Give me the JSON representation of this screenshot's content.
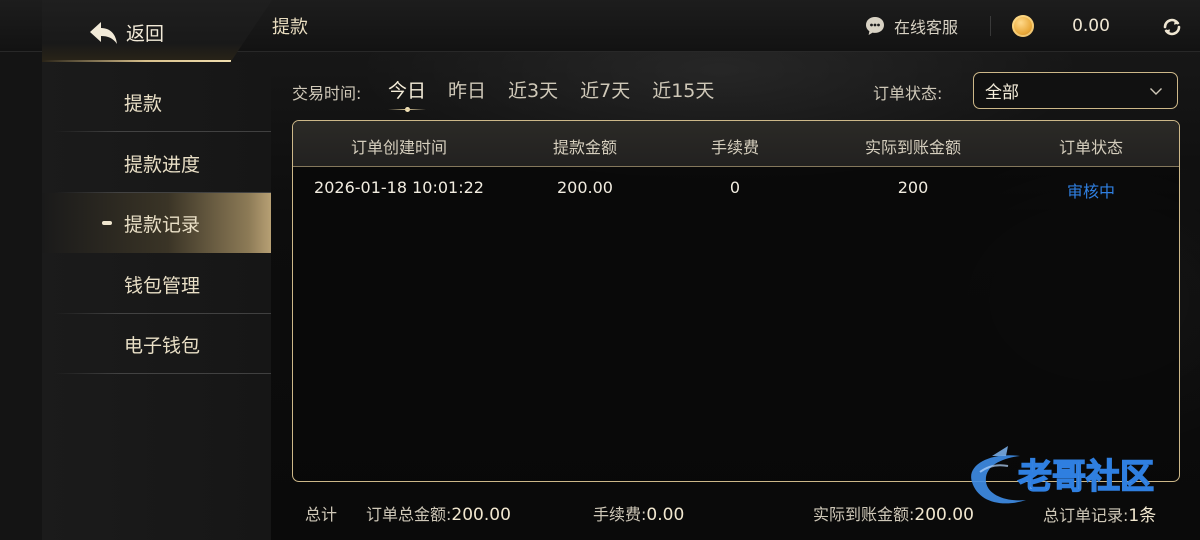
{
  "header": {
    "back_label": "返回",
    "title": "提款",
    "customer_service": "在线客服",
    "balance": "0.00"
  },
  "sidebar": {
    "items": [
      {
        "label": "提款",
        "active": false
      },
      {
        "label": "提款进度",
        "active": false
      },
      {
        "label": "提款记录",
        "active": true
      },
      {
        "label": "钱包管理",
        "active": false
      },
      {
        "label": "电子钱包",
        "active": false
      }
    ]
  },
  "filters": {
    "time_label": "交易时间:",
    "time_options": [
      "今日",
      "昨日",
      "近3天",
      "近7天",
      "近15天"
    ],
    "active_time": "今日",
    "status_label": "订单状态:",
    "status_value": "全部"
  },
  "table": {
    "columns": [
      "订单创建时间",
      "提款金额",
      "手续费",
      "实际到账金额",
      "订单状态"
    ],
    "rows": [
      [
        "2026-01-18 10:01:22",
        "200.00",
        "0",
        "200",
        "审核中"
      ]
    ]
  },
  "totals": {
    "label": "总计",
    "order_total_label": "订单总金额:",
    "order_total_value": "200.00",
    "fee_label": "手续费:",
    "fee_value": "0.00",
    "received_label": "实际到账金额:",
    "received_value": "200.00",
    "count_label": "总订单记录:",
    "count_value": "1条"
  },
  "watermark": {
    "text": "老哥社区"
  },
  "colors": {
    "accent_gold": "#cdb889",
    "status_pending": "#2f7fe0",
    "background": "#0d0d0d"
  },
  "icons": {
    "back": "back-arrow-icon",
    "customer_service": "chat-icon",
    "coin": "coin-icon",
    "refresh": "refresh-icon",
    "dropdown": "chevron-down-icon"
  }
}
